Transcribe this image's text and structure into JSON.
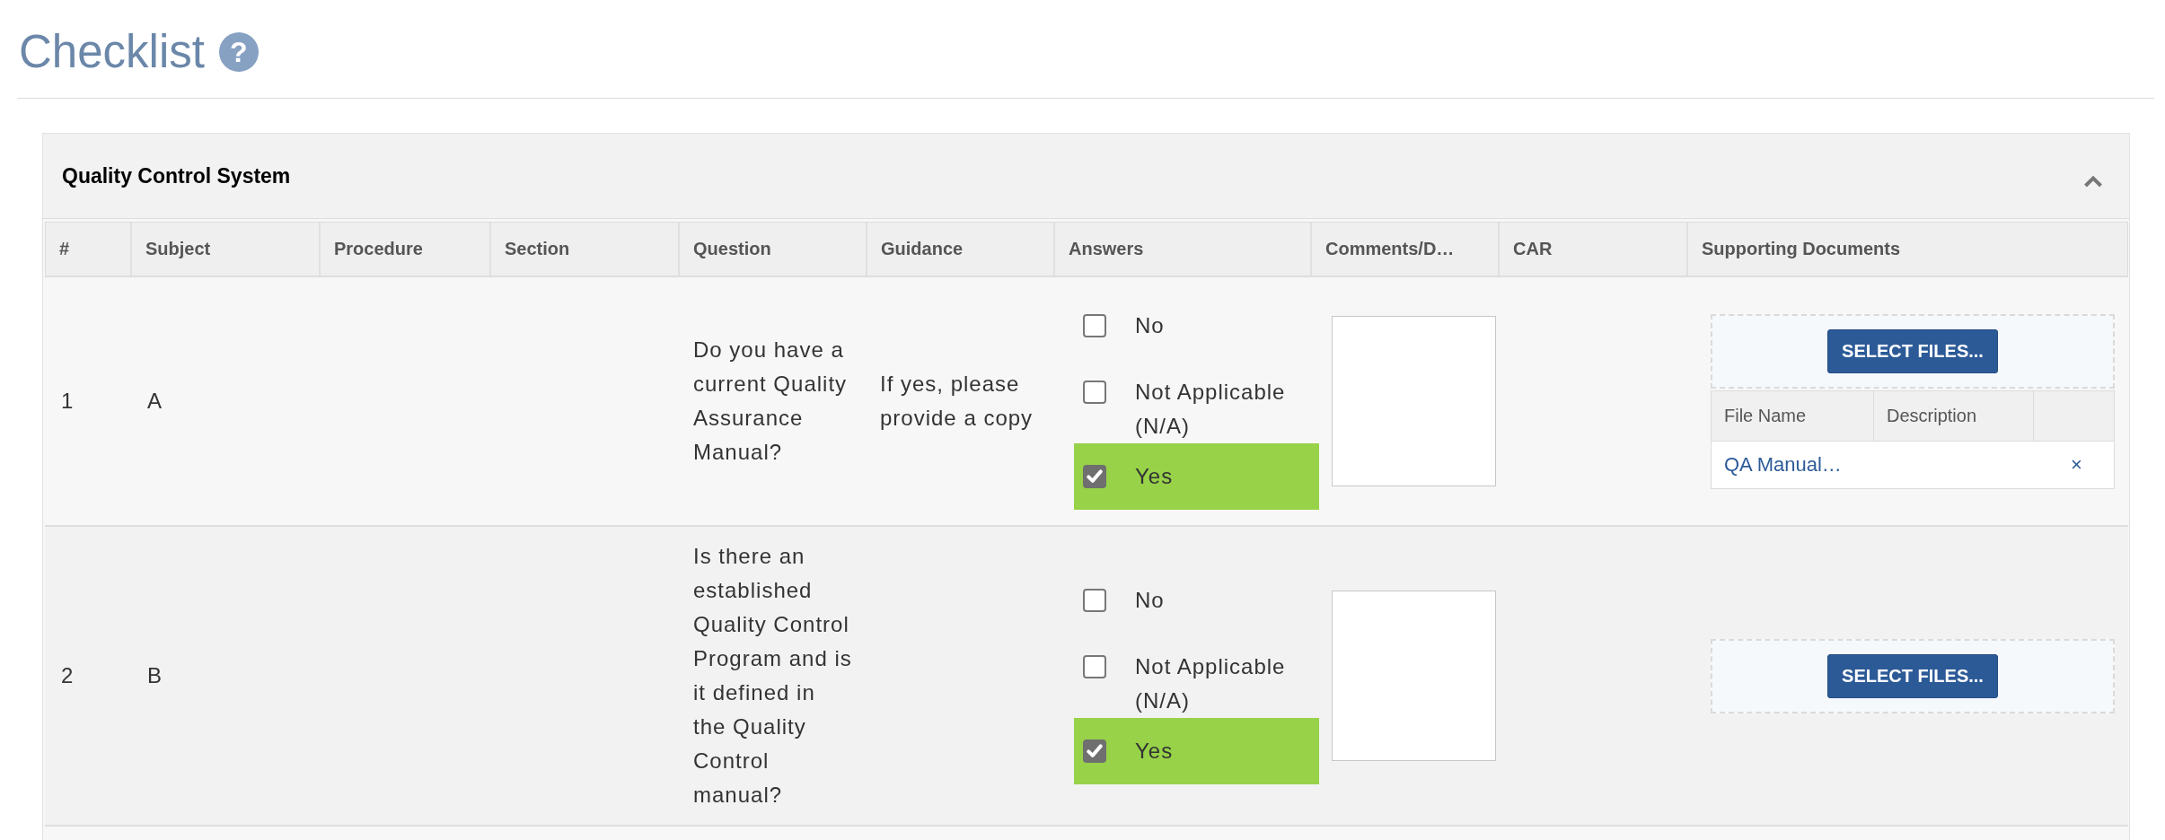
{
  "page": {
    "title": "Checklist",
    "help": "?"
  },
  "section": {
    "title": "Quality Control System",
    "expanded": true
  },
  "table": {
    "columns": [
      "#",
      "Subject",
      "Procedure",
      "Section",
      "Question",
      "Guidance",
      "Answers",
      "Comments/D…",
      "CAR",
      "Supporting Documents"
    ],
    "rows": [
      {
        "number": "1",
        "subject": "A",
        "question": "Do you have a current Quality Assurance Manual?",
        "guidance": "If yes, please provide a copy",
        "answers": [
          {
            "label": "No",
            "checked": false
          },
          {
            "label": "Not Applicable (N/A)",
            "checked": false
          },
          {
            "label": "Yes",
            "checked": true
          }
        ],
        "documents": {
          "button": "SELECT FILES...",
          "file_columns": [
            "File Name",
            "Description"
          ],
          "files": [
            {
              "name": "QA Manual…",
              "remove": "×"
            }
          ]
        }
      },
      {
        "number": "2",
        "subject": "B",
        "question": "Is there an established Quality Control Program and is it defined in the Quality Control manual?",
        "answers": [
          {
            "label": "No",
            "checked": false
          },
          {
            "label": "Not Applicable (N/A)",
            "checked": false
          },
          {
            "label": "Yes",
            "checked": true
          }
        ],
        "documents": {
          "button": "SELECT FILES..."
        }
      }
    ]
  }
}
